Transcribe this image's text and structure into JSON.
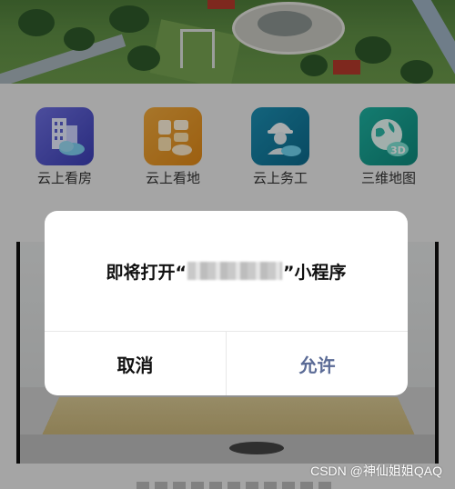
{
  "features": [
    {
      "label": "云上看房",
      "icon": "building-cloud-icon"
    },
    {
      "label": "云上看地",
      "icon": "land-plots-icon"
    },
    {
      "label": "云上务工",
      "icon": "worker-helmet-icon"
    },
    {
      "label": "三维地图",
      "icon": "globe-3d-icon"
    }
  ],
  "dialog": {
    "title_prefix": "即将打开“",
    "title_suffix": "”小程序",
    "cancel_label": "取消",
    "allow_label": "允许"
  },
  "watermark": "CSDN @神仙姐姐QAQ",
  "colors": {
    "allow_text": "#5b6b96",
    "overlay": "rgba(0,0,0,0.30)"
  }
}
